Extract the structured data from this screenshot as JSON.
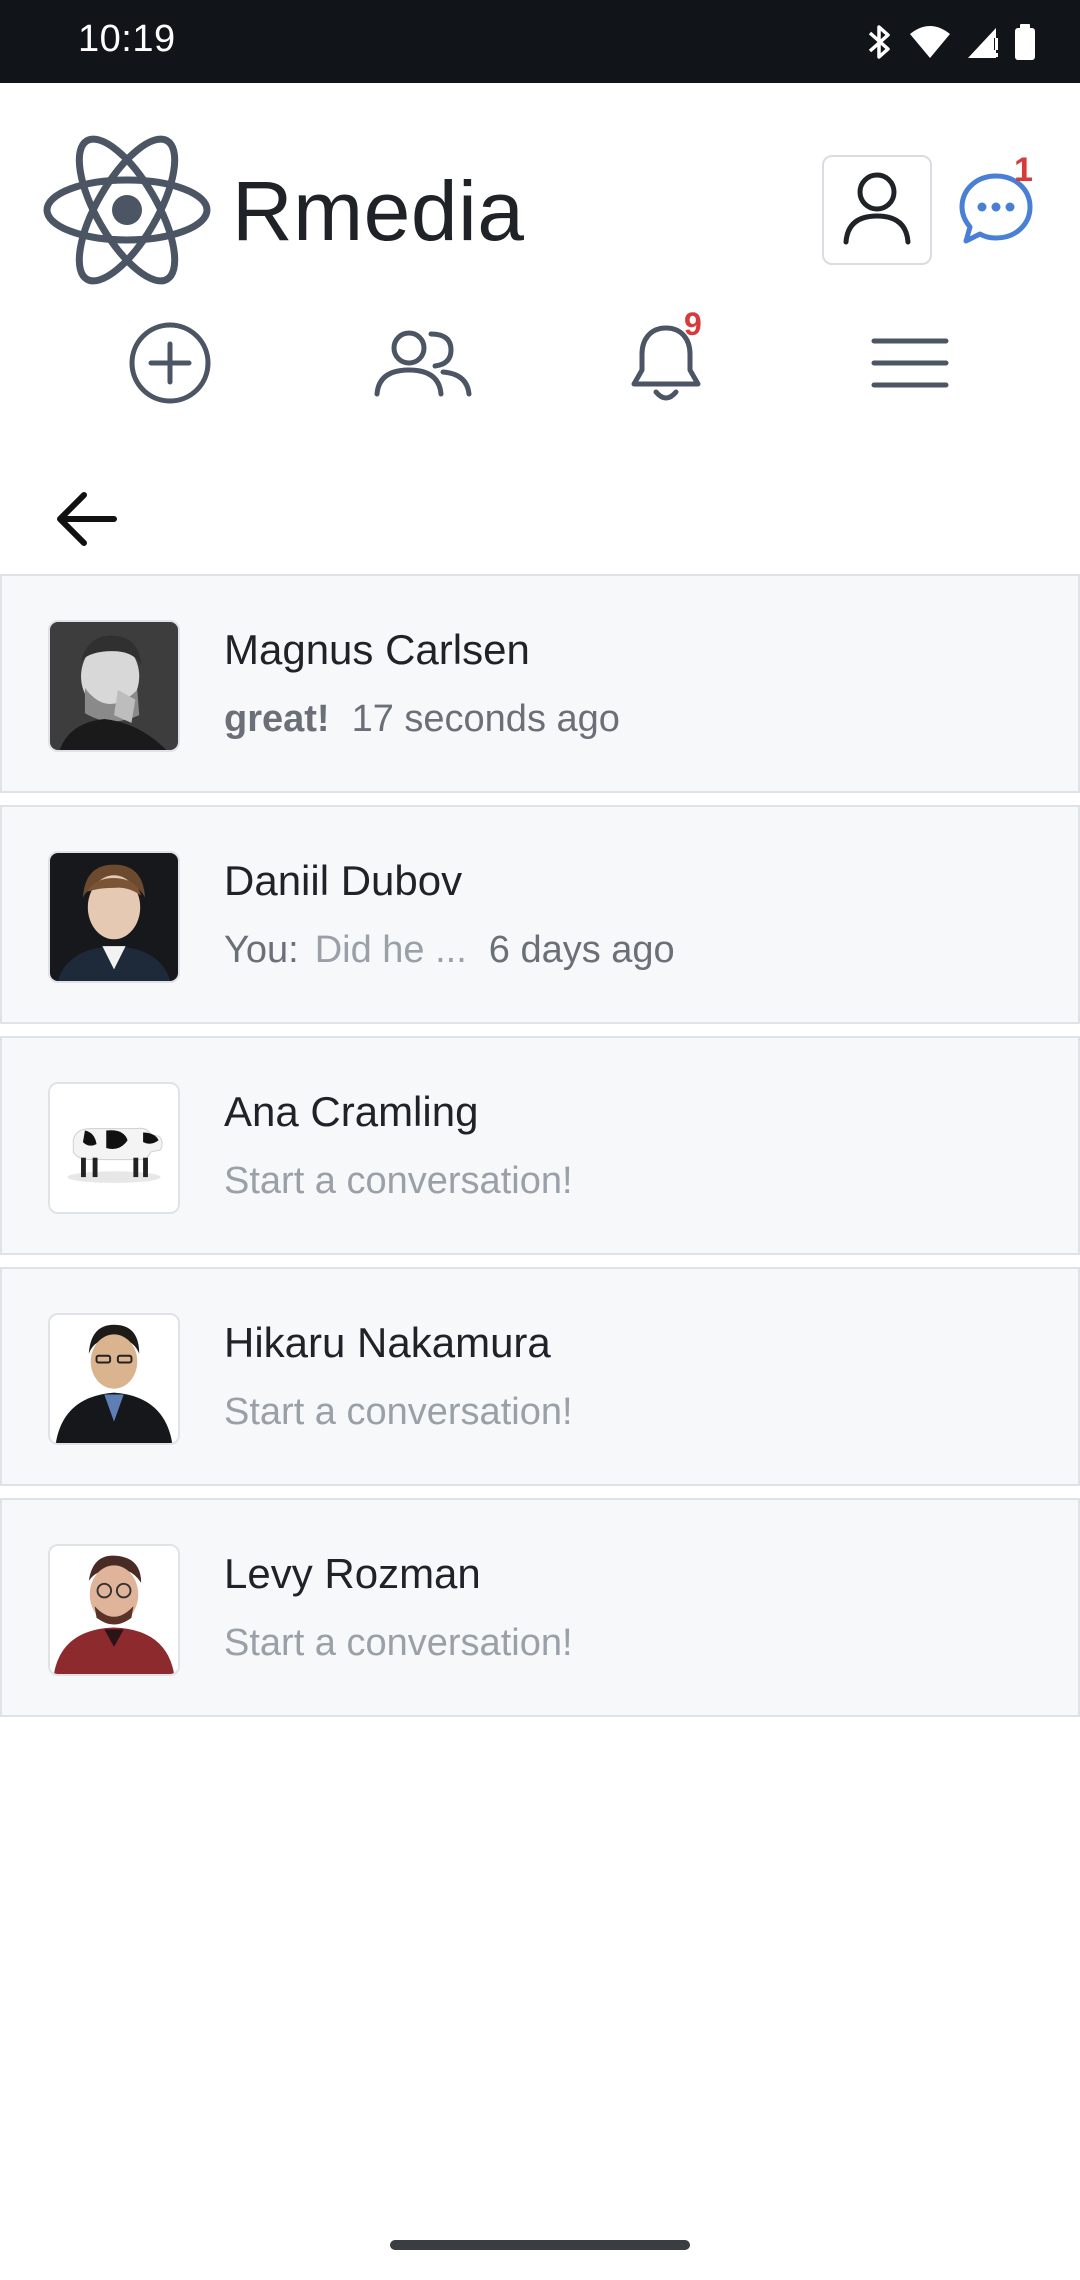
{
  "status_bar": {
    "time": "10:19",
    "icons": [
      "bluetooth-icon",
      "wifi-icon",
      "signal-icon",
      "battery-icon"
    ]
  },
  "header": {
    "app_title": "Rmedia",
    "logo_icon": "react-atom-icon",
    "profile_icon": "user-icon",
    "messages_icon": "chat-bubble-icon",
    "messages_badge": "1"
  },
  "nav": {
    "items": [
      {
        "icon": "add-circle-icon"
      },
      {
        "icon": "friends-icon"
      },
      {
        "icon": "bell-icon",
        "badge": "9"
      },
      {
        "icon": "menu-icon"
      }
    ]
  },
  "back": {
    "icon": "arrow-left-icon"
  },
  "conversations": [
    {
      "name": "Magnus Carlsen",
      "message": "great!",
      "time": "17 seconds ago"
    },
    {
      "name": "Daniil Dubov",
      "prefix": "You:",
      "message": "Did he ...",
      "time": "6 days ago"
    },
    {
      "name": "Ana Cramling",
      "placeholder": "Start a conversation!"
    },
    {
      "name": "Hikaru Nakamura",
      "placeholder": "Start a conversation!"
    },
    {
      "name": "Levy Rozman",
      "placeholder": "Start a conversation!"
    }
  ],
  "colors": {
    "accent_blue": "#4a7fd6",
    "badge_red": "#d73a3a",
    "icon_gray": "#4b5563",
    "list_bg": "#f7f8fa"
  }
}
